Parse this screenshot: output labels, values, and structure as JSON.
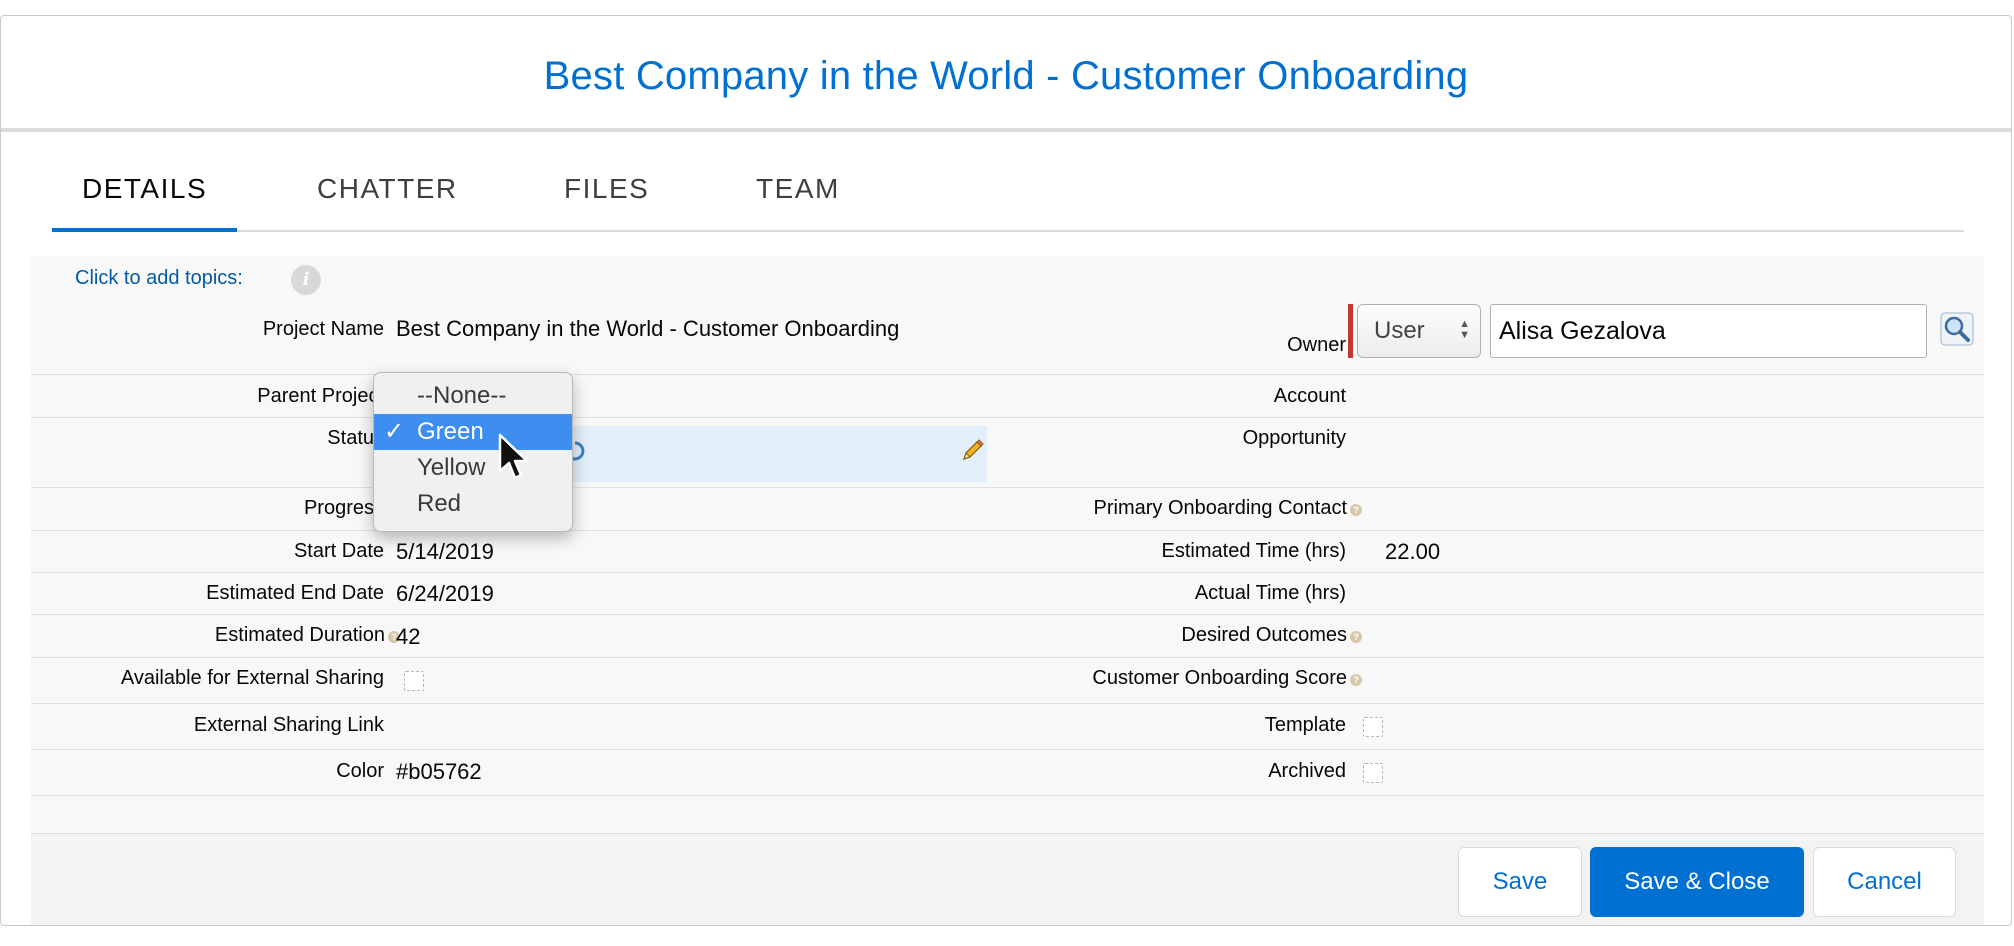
{
  "modal": {
    "title": "Best Company in the World - Customer Onboarding"
  },
  "tabs": [
    {
      "label": "DETAILS",
      "active": true
    },
    {
      "label": "CHATTER",
      "active": false
    },
    {
      "label": "FILES",
      "active": false
    },
    {
      "label": "TEAM",
      "active": false
    }
  ],
  "topics": {
    "link_text": "Click to add topics:",
    "icon": "info-icon"
  },
  "fields": {
    "project_name": {
      "label": "Project Name",
      "value": "Best Company in the World - Customer Onboarding"
    },
    "owner": {
      "label": "Owner",
      "type_select": "User",
      "value": "Alisa Gezalova",
      "lookup_icon": "lookup-icon"
    },
    "parent_project": {
      "label": "Parent Project",
      "value": ""
    },
    "account": {
      "label": "Account",
      "value": ""
    },
    "status": {
      "label": "Status",
      "value": "Green",
      "edit_icon": "pencil-icon"
    },
    "opportunity": {
      "label": "Opportunity",
      "value": ""
    },
    "progress": {
      "label": "Progress",
      "value": ""
    },
    "primary_contact": {
      "label": "Primary Onboarding Contact",
      "value": ""
    },
    "start_date": {
      "label": "Start Date",
      "value": "5/14/2019"
    },
    "estimated_time": {
      "label": "Estimated Time (hrs)",
      "value": "22.00"
    },
    "estimated_end_date": {
      "label": "Estimated End Date",
      "value": "6/24/2019"
    },
    "actual_time": {
      "label": "Actual Time (hrs)",
      "value": ""
    },
    "estimated_duration": {
      "label": "Estimated Duration",
      "value": "42"
    },
    "desired_outcomes": {
      "label": "Desired Outcomes",
      "value": ""
    },
    "external_sharing": {
      "label": "Available for External Sharing",
      "checked": false
    },
    "onboarding_score": {
      "label": "Customer Onboarding Score",
      "value": ""
    },
    "external_link": {
      "label": "External Sharing Link",
      "value": ""
    },
    "template": {
      "label": "Template",
      "checked": false
    },
    "color": {
      "label": "Color",
      "value": "#b05762"
    },
    "archived": {
      "label": "Archived",
      "checked": false
    }
  },
  "status_dropdown": {
    "options": [
      "--None--",
      "Green",
      "Yellow",
      "Red"
    ],
    "selected": "Green"
  },
  "buttons": {
    "save": "Save",
    "save_close": "Save & Close",
    "cancel": "Cancel"
  },
  "colors": {
    "brand": "#0070d2",
    "required": "#c23934",
    "selection": "#3d8ef0",
    "status_edit_bg": "#e2effa"
  }
}
